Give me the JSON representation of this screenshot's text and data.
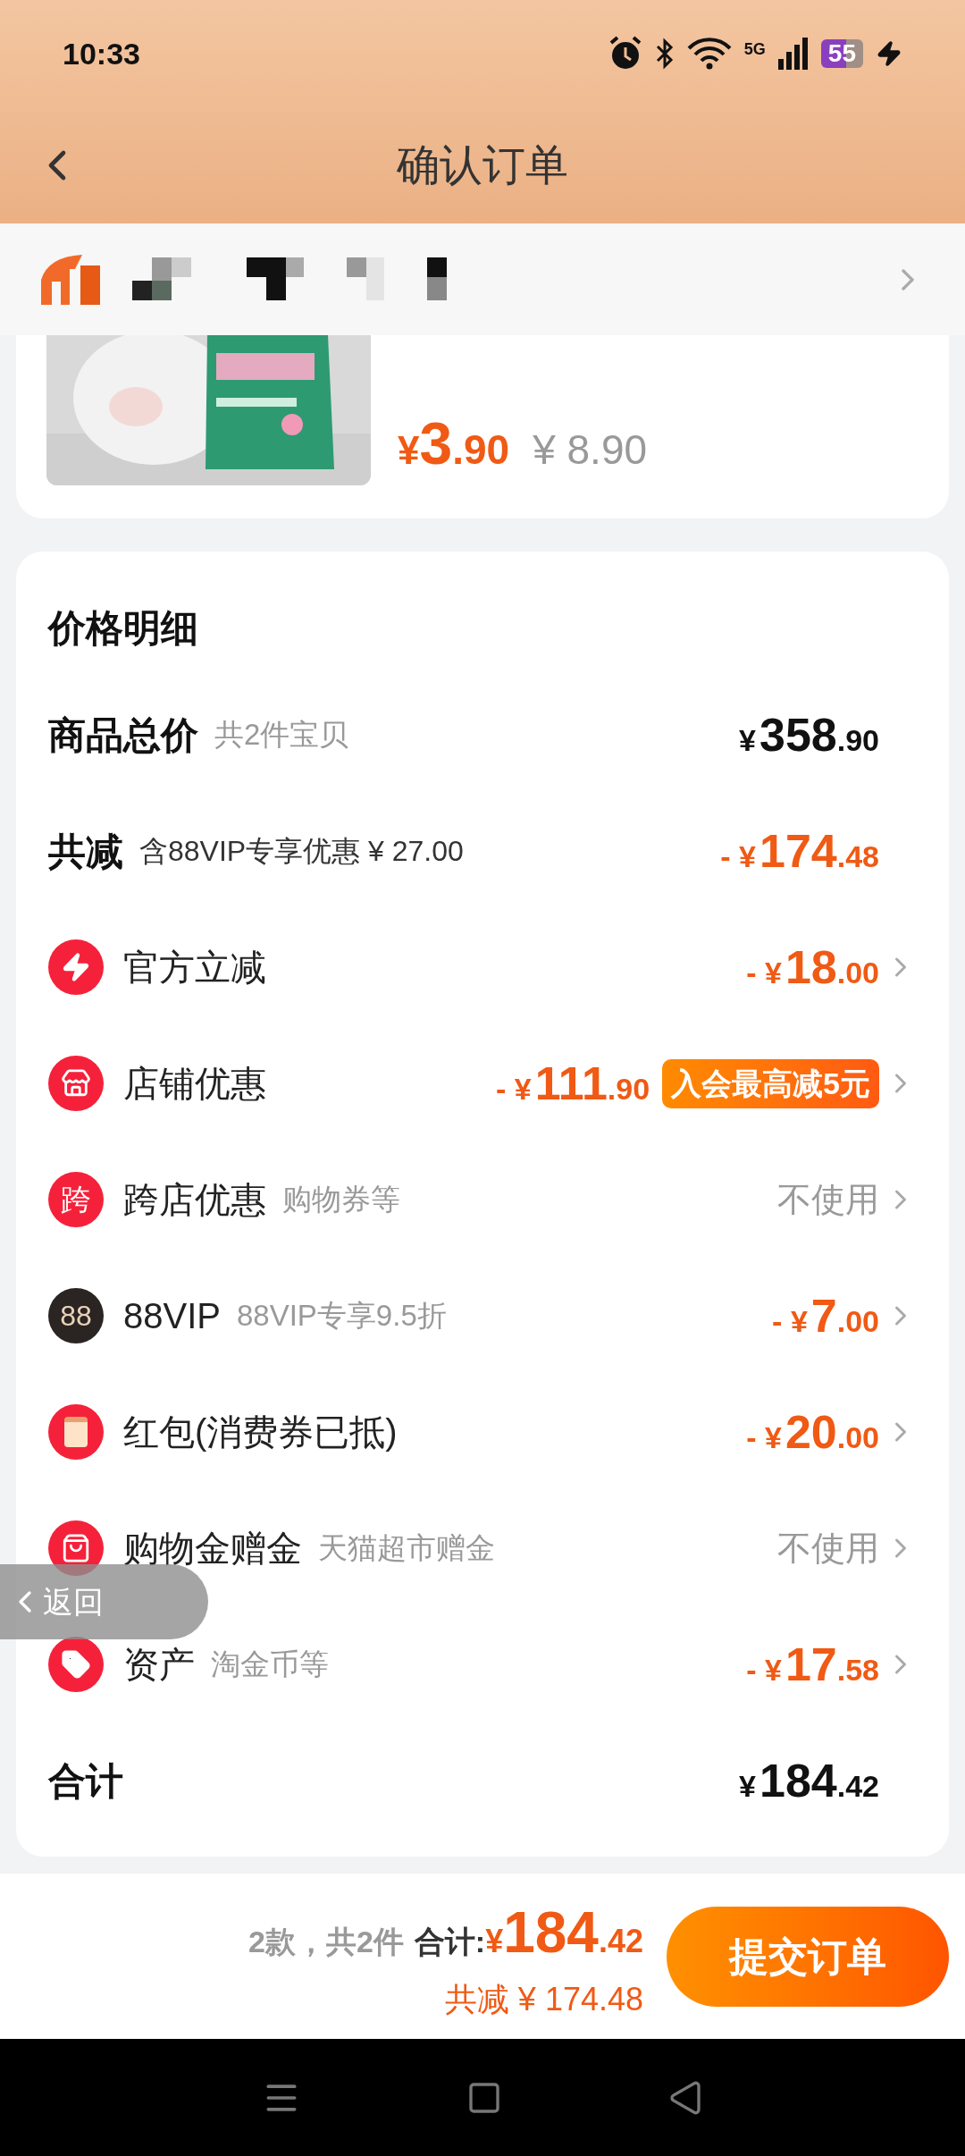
{
  "status_bar": {
    "time": "10:33",
    "network": "5G",
    "battery": "55"
  },
  "header": {
    "title": "确认订单"
  },
  "product": {
    "price_currency": "¥",
    "price_int": "3",
    "price_dec": ".90",
    "original_price": "¥ 8.90"
  },
  "price_detail": {
    "title": "价格明细",
    "rows": [
      {
        "kind": "summary",
        "label": "商品总价",
        "note": "共2件宝贝",
        "value": {
          "kind": "amount",
          "currency": "¥",
          "int": "358",
          "dec": ".90"
        }
      },
      {
        "kind": "summary",
        "label": "共减",
        "note": "含88VIP专享优惠 ¥ 27.00",
        "value": {
          "kind": "amount",
          "sign": "-",
          "currency": "¥",
          "int": "174",
          "dec": ".48"
        }
      },
      {
        "kind": "item",
        "label": "官方立减",
        "value": {
          "kind": "amount",
          "sign": "-",
          "currency": "¥",
          "int": "18",
          "dec": ".00"
        }
      },
      {
        "kind": "item",
        "label": "店铺优惠",
        "value": {
          "kind": "amount",
          "sign": "-",
          "currency": "¥",
          "int": "111",
          "dec": ".90"
        },
        "badge": "入会最高减5元"
      },
      {
        "kind": "item",
        "icon_text": "跨",
        "label": "跨店优惠",
        "note": "购物券等",
        "value": {
          "kind": "text",
          "text": "不使用"
        }
      },
      {
        "kind": "item",
        "icon_text": "88",
        "label": "88VIP",
        "note": "88VIP专享9.5折",
        "value": {
          "kind": "amount",
          "sign": "-",
          "currency": "¥",
          "int": "7",
          "dec": ".00"
        }
      },
      {
        "kind": "item",
        "label": "红包(消费券已抵)",
        "value": {
          "kind": "amount",
          "sign": "-",
          "currency": "¥",
          "int": "20",
          "dec": ".00"
        }
      },
      {
        "kind": "item",
        "label": "购物金赠金",
        "note": "天猫超市赠金",
        "value": {
          "kind": "text",
          "text": "不使用"
        }
      },
      {
        "kind": "item",
        "label": "资产",
        "note": "淘金币等",
        "value": {
          "kind": "amount",
          "sign": "-",
          "currency": "¥",
          "int": "17",
          "dec": ".58"
        }
      },
      {
        "kind": "total",
        "label": "合计",
        "value": {
          "kind": "amount",
          "currency": "¥",
          "int": "184",
          "dec": ".42"
        }
      }
    ]
  },
  "floating_back": {
    "label": "返回"
  },
  "footer": {
    "count": "2款，共2件",
    "total_label": "合计:",
    "currency": "¥",
    "total_int": "184",
    "total_dec": ".42",
    "saving": "共减 ¥ 174.48",
    "submit": "提交订单"
  }
}
